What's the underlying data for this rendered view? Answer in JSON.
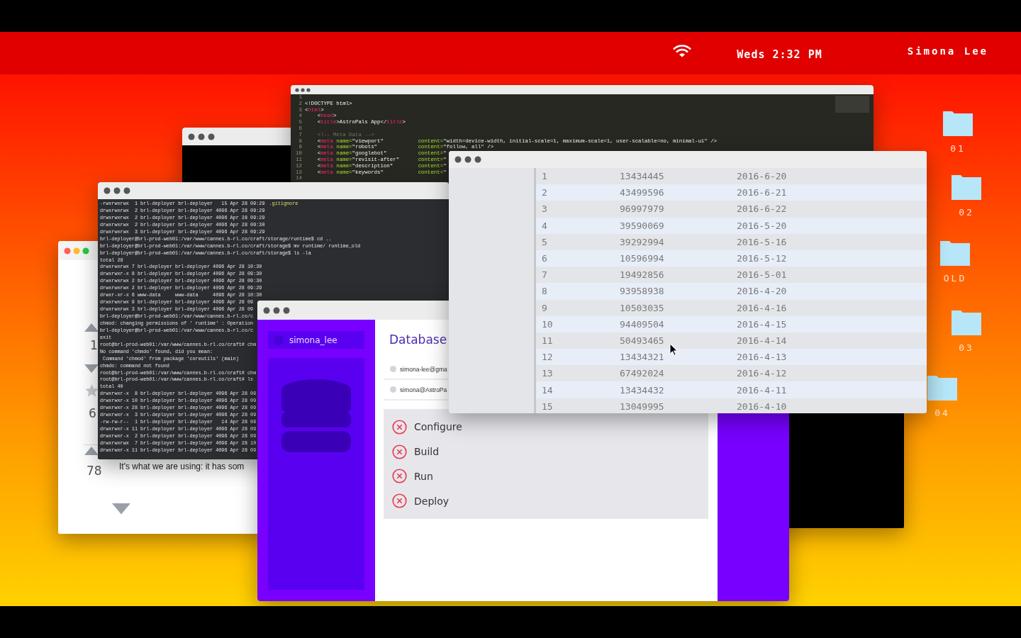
{
  "top_bar": {
    "clock": "Weds 2:32 PM",
    "user": "Simona Lee"
  },
  "desktop_folders": [
    {
      "label": "01"
    },
    {
      "label": "02"
    },
    {
      "label": "OLD"
    },
    {
      "label": "03"
    },
    {
      "label": "04"
    }
  ],
  "code_window": {
    "lines": [
      {
        "n": "1"
      },
      {
        "n": "2",
        "seg": [
          {
            "kind": "plain",
            "text": "<!DOCTYPE html>"
          }
        ]
      },
      {
        "n": "3",
        "seg": [
          {
            "kind": "plain",
            "text": "<"
          },
          {
            "kind": "tag",
            "text": "html"
          },
          {
            "kind": "plain",
            "text": ">"
          }
        ]
      },
      {
        "n": "4",
        "seg": [
          {
            "kind": "plain",
            "text": "    <"
          },
          {
            "kind": "tag",
            "text": "head"
          },
          {
            "kind": "plain",
            "text": ">"
          }
        ]
      },
      {
        "n": "5",
        "seg": [
          {
            "kind": "plain",
            "text": "    <"
          },
          {
            "kind": "tag",
            "text": "title"
          },
          {
            "kind": "plain",
            "text": ">AstroPals App</"
          },
          {
            "kind": "tag",
            "text": "title"
          },
          {
            "kind": "plain",
            "text": ">"
          }
        ]
      },
      {
        "n": "6"
      },
      {
        "n": "7",
        "seg": [
          {
            "kind": "comment",
            "text": "    <!-- Meta Data -->"
          }
        ]
      },
      {
        "n": "8",
        "seg": [
          {
            "kind": "plain",
            "text": "    <"
          },
          {
            "kind": "tag",
            "text": "meta"
          },
          {
            "kind": "attr",
            "text": " name="
          },
          {
            "kind": "value",
            "text": "\"viewport\""
          }
        ],
        "column": [
          {
            "kind": "attr",
            "text": "content="
          },
          {
            "kind": "value",
            "text": "\"width=device-width, initial-scale=1, maximum-scale=1, user-scalable=no, minimal-ui\""
          },
          {
            "kind": "plain",
            "text": " />"
          }
        ]
      },
      {
        "n": "9",
        "seg": [
          {
            "kind": "plain",
            "text": "    <"
          },
          {
            "kind": "tag",
            "text": "meta"
          },
          {
            "kind": "attr",
            "text": " name="
          },
          {
            "kind": "value",
            "text": "\"robots\""
          }
        ],
        "column": [
          {
            "kind": "attr",
            "text": "content="
          },
          {
            "kind": "value",
            "text": "\"follow, all\""
          },
          {
            "kind": "plain",
            "text": " />"
          }
        ]
      },
      {
        "n": "10",
        "seg": [
          {
            "kind": "plain",
            "text": "    <"
          },
          {
            "kind": "tag",
            "text": "meta"
          },
          {
            "kind": "attr",
            "text": " name="
          },
          {
            "kind": "value",
            "text": "\"googlebot\""
          }
        ],
        "column": [
          {
            "kind": "attr",
            "text": "content="
          },
          {
            "kind": "value",
            "text": "\""
          }
        ]
      },
      {
        "n": "11",
        "seg": [
          {
            "kind": "plain",
            "text": "    <"
          },
          {
            "kind": "tag",
            "text": "meta"
          },
          {
            "kind": "attr",
            "text": " name="
          },
          {
            "kind": "value",
            "text": "\"revisit-after\""
          }
        ],
        "column": [
          {
            "kind": "attr",
            "text": "content="
          },
          {
            "kind": "value",
            "text": "\""
          }
        ]
      },
      {
        "n": "12",
        "seg": [
          {
            "kind": "plain",
            "text": "    <"
          },
          {
            "kind": "tag",
            "text": "meta"
          },
          {
            "kind": "attr",
            "text": " name="
          },
          {
            "kind": "value",
            "text": "\"description\""
          }
        ],
        "column": [
          {
            "kind": "attr",
            "text": "content="
          },
          {
            "kind": "value",
            "text": "\""
          }
        ]
      },
      {
        "n": "13",
        "seg": [
          {
            "kind": "plain",
            "text": "    <"
          },
          {
            "kind": "tag",
            "text": "meta"
          },
          {
            "kind": "attr",
            "text": " name="
          },
          {
            "kind": "value",
            "text": "\"keywords\""
          }
        ],
        "column": [
          {
            "kind": "attr",
            "text": "content="
          },
          {
            "kind": "value",
            "text": "\""
          }
        ]
      },
      {
        "n": "14"
      }
    ]
  },
  "terminal_window": {
    "lines": [
      {
        "t": "-rwxrwxrwx  1 brl-deployer brl-deployer   15 Apr 28 09:29",
        "file": ".gitignore"
      },
      {
        "t": "drwxrwxrwx  2 brl-deployer brl-deployer 4096 Apr 28 09:29"
      },
      {
        "t": "drwxrwxrwx  2 brl-deployer brl-deployer 4096 Apr 28 09:29"
      },
      {
        "t": "drwxrwxrwx  2 brl-deployer brl-deployer 4096 Apr 28 09:30"
      },
      {
        "t": "drwxrwxrwx  3 brl-deployer brl-deployer 4096 Apr 28 09:29"
      },
      {
        "t": "brl-deployer@brl-prod-web01:/var/www/cannes.b-rl.co/craft/storage/runtime$ cd .."
      },
      {
        "t": "brl-deployer@brl-prod-web01:/var/www/cannes.b-rl.co/craft/storage$ mv runtime/ runtime_old"
      },
      {
        "t": "brl-deployer@brl-prod-web01:/var/www/cannes.b-rl.co/craft/storage$ ls -la"
      },
      {
        "t": "total 28"
      },
      {
        "t": "drwxrwxrwx 7 brl-deployer brl-deployer 4096 Apr 28 10:30"
      },
      {
        "t": "drwxrwxr-x 8 brl-deployer brl-deployer 4096 Apr 28 09:30"
      },
      {
        "t": "drwxrwxrwx 2 brl-deployer brl-deployer 4096 Apr 28 09:30"
      },
      {
        "t": "drwxrwxrwx 2 brl-deployer brl-deployer 4096 Apr 28 09:29"
      },
      {
        "t": "drwxr-xr-x 6 www-data     www-data     4096 Apr 28 10:30"
      },
      {
        "t": "drwxrwxrwx 9 brl-deployer brl-deployer 4096 Apr 28 09"
      },
      {
        "t": "drwxrwxrwx 3 brl-deployer brl-deployer 4096 Apr 28 09"
      },
      {
        "t": "brl-deployer@brl-prod-web01:/var/www/cannes.b-rl.co/c"
      },
      {
        "t": "chmod: changing permissions of ' runtime' : Operation"
      },
      {
        "t": "brl-deployer@brl-prod-web01:/var/www/cannes.b-rl.co/c"
      },
      {
        "t": "exit"
      },
      {
        "t": "root@brl-prod-web01:/var/www/cannes.b-rl.co/craft# chm"
      },
      {
        "t": "No command 'chmdo' found, did you mean:"
      },
      {
        "t": " Command 'chmod' from package 'coreutils' (main)"
      },
      {
        "t": "chmdo: command not found"
      },
      {
        "t": "root@brl-prod-web01:/var/www/cannes.b-rl.co/craft# chm"
      },
      {
        "t": "root@brl-prod-web01:/var/www/cannes.b-rl.co/craft# ls"
      },
      {
        "t": "total 40"
      },
      {
        "t": "drwxrwxr-x  8 brl-deployer brl-deployer 4096 Apr 28 09"
      },
      {
        "t": "drwxrwxr-x 10 brl-deployer brl-deployer 4096 Apr 28 09"
      },
      {
        "t": "drwxrwxr-x 28 brl-deployer brl-deployer 4096 Apr 28 09"
      },
      {
        "t": "drwxrwxr-x  3 brl-deployer brl-deployer 4096 Apr 28 09"
      },
      {
        "t": "-rw-rw-r--  1 brl-deployer brl-deployer   14 Apr 28 09"
      },
      {
        "t": "drwxrwxr-x 11 brl-deployer brl-deployer 4096 Apr 28 09"
      },
      {
        "t": "drwxrwxr-x  2 brl-deployer brl-deployer 4096 Apr 28 09"
      },
      {
        "t": "drwxrwxrwx  7 brl-deployer brl-deployer 4096 Apr 28 10"
      },
      {
        "t": "drwxrwxr-x 11 brl-deployer brl-deployer 4096 Apr 28 09"
      }
    ]
  },
  "qa_window": {
    "question_votes": "1",
    "favorites": "6",
    "answer_votes": "78",
    "answer_text": "It's what we are using: it has som"
  },
  "database_window": {
    "user": "simona_lee",
    "title": "Database",
    "emails": [
      "simona-lee@gma",
      "simona@AstroPa"
    ],
    "steps": [
      {
        "label": "Configure",
        "kind": "failed"
      },
      {
        "label": "Build",
        "kind": "failed"
      },
      {
        "label": "Run",
        "kind": "failed"
      },
      {
        "label": "Deploy",
        "kind": "failed"
      }
    ]
  },
  "table_window": {
    "rows": [
      [
        "1",
        "13434445",
        "2016-6-20"
      ],
      [
        "2",
        "43499596",
        "2016-6-21"
      ],
      [
        "3",
        "96997979",
        "2016-6-22"
      ],
      [
        "4",
        "39590069",
        "2016-5-20"
      ],
      [
        "5",
        "39292994",
        "2016-5-16"
      ],
      [
        "6",
        "10596994",
        "2016-5-12"
      ],
      [
        "7",
        "19492856",
        "2016-5-01"
      ],
      [
        "8",
        "93958938",
        "2016-4-20"
      ],
      [
        "9",
        "10503035",
        "2016-4-16"
      ],
      [
        "10",
        "94409504",
        "2016-4-15"
      ],
      [
        "11",
        "50493465",
        "2016-4-14"
      ],
      [
        "12",
        "13434321",
        "2016-4-13"
      ],
      [
        "13",
        "67492024",
        "2016-4-12"
      ],
      [
        "14",
        "13434432",
        "2016-4-11"
      ],
      [
        "15",
        "13049995",
        "2016-4-10"
      ]
    ]
  }
}
